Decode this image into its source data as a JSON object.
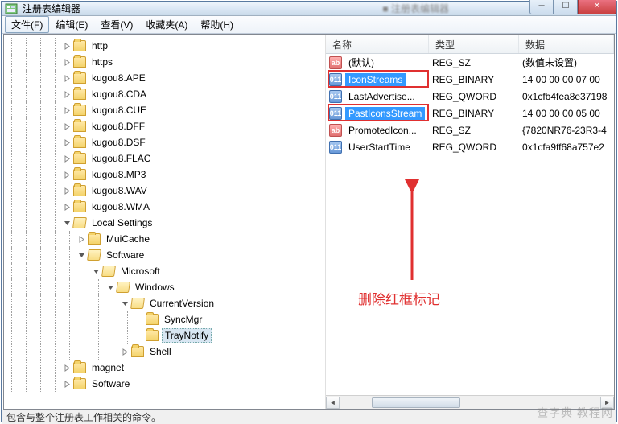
{
  "window": {
    "title": "注册表编辑器",
    "blurred_center": "■ 注册表编辑器"
  },
  "menus": {
    "file": {
      "label": "文件(F)"
    },
    "edit": {
      "label": "编辑(E)"
    },
    "view": {
      "label": "查看(V)"
    },
    "fav": {
      "label": "收藏夹(A)"
    },
    "help": {
      "label": "帮助(H)"
    }
  },
  "tree": {
    "items": [
      {
        "depth": 4,
        "label": "http",
        "exp": "closed",
        "has_children": true
      },
      {
        "depth": 4,
        "label": "https",
        "exp": "closed",
        "has_children": true
      },
      {
        "depth": 4,
        "label": "kugou8.APE",
        "exp": "closed",
        "has_children": true
      },
      {
        "depth": 4,
        "label": "kugou8.CDA",
        "exp": "closed",
        "has_children": true
      },
      {
        "depth": 4,
        "label": "kugou8.CUE",
        "exp": "closed",
        "has_children": true
      },
      {
        "depth": 4,
        "label": "kugou8.DFF",
        "exp": "closed",
        "has_children": true
      },
      {
        "depth": 4,
        "label": "kugou8.DSF",
        "exp": "closed",
        "has_children": true
      },
      {
        "depth": 4,
        "label": "kugou8.FLAC",
        "exp": "closed",
        "has_children": true
      },
      {
        "depth": 4,
        "label": "kugou8.MP3",
        "exp": "closed",
        "has_children": true
      },
      {
        "depth": 4,
        "label": "kugou8.WAV",
        "exp": "closed",
        "has_children": true
      },
      {
        "depth": 4,
        "label": "kugou8.WMA",
        "exp": "closed",
        "has_children": true
      },
      {
        "depth": 4,
        "label": "Local Settings",
        "exp": "open",
        "has_children": true
      },
      {
        "depth": 5,
        "label": "MuiCache",
        "exp": "closed",
        "has_children": true
      },
      {
        "depth": 5,
        "label": "Software",
        "exp": "open",
        "has_children": true
      },
      {
        "depth": 6,
        "label": "Microsoft",
        "exp": "open",
        "has_children": true
      },
      {
        "depth": 7,
        "label": "Windows",
        "exp": "open",
        "has_children": true
      },
      {
        "depth": 8,
        "label": "CurrentVersion",
        "exp": "open",
        "has_children": true
      },
      {
        "depth": 9,
        "label": "SyncMgr",
        "exp": "none",
        "has_children": false
      },
      {
        "depth": 9,
        "label": "TrayNotify",
        "exp": "none",
        "has_children": false,
        "selected": true
      },
      {
        "depth": 8,
        "label": "Shell",
        "exp": "closed",
        "has_children": true
      },
      {
        "depth": 4,
        "label": "magnet",
        "exp": "closed",
        "has_children": true
      },
      {
        "depth": 4,
        "label": "Software",
        "exp": "closed",
        "has_children": true
      }
    ]
  },
  "list": {
    "headers": {
      "name": "名称",
      "type": "类型",
      "data": "数据"
    },
    "rows": [
      {
        "icon": "str",
        "name": "(默认)",
        "type": "REG_SZ",
        "data": "(数值未设置)"
      },
      {
        "icon": "bin",
        "name": "IconStreams",
        "type": "REG_BINARY",
        "data": "14 00 00 00 07 00",
        "highlight": true,
        "redbox": true
      },
      {
        "icon": "bin",
        "name": "LastAdvertise...",
        "type": "REG_QWORD",
        "data": "0x1cfb4fea8e37198"
      },
      {
        "icon": "bin",
        "name": "PastIconsStream",
        "type": "REG_BINARY",
        "data": "14 00 00 00 05 00",
        "highlight": true,
        "redbox": true
      },
      {
        "icon": "str",
        "name": "PromotedIcon...",
        "type": "REG_SZ",
        "data": "{7820NR76-23R3-4"
      },
      {
        "icon": "bin",
        "name": "UserStartTime",
        "type": "REG_QWORD",
        "data": "0x1cfa9ff68a757e2"
      }
    ]
  },
  "annotation": {
    "text": "删除红框标记"
  },
  "statusbar": {
    "text": "包含与整个注册表工作相关的命令。"
  },
  "watermark": "查字典   教程网"
}
